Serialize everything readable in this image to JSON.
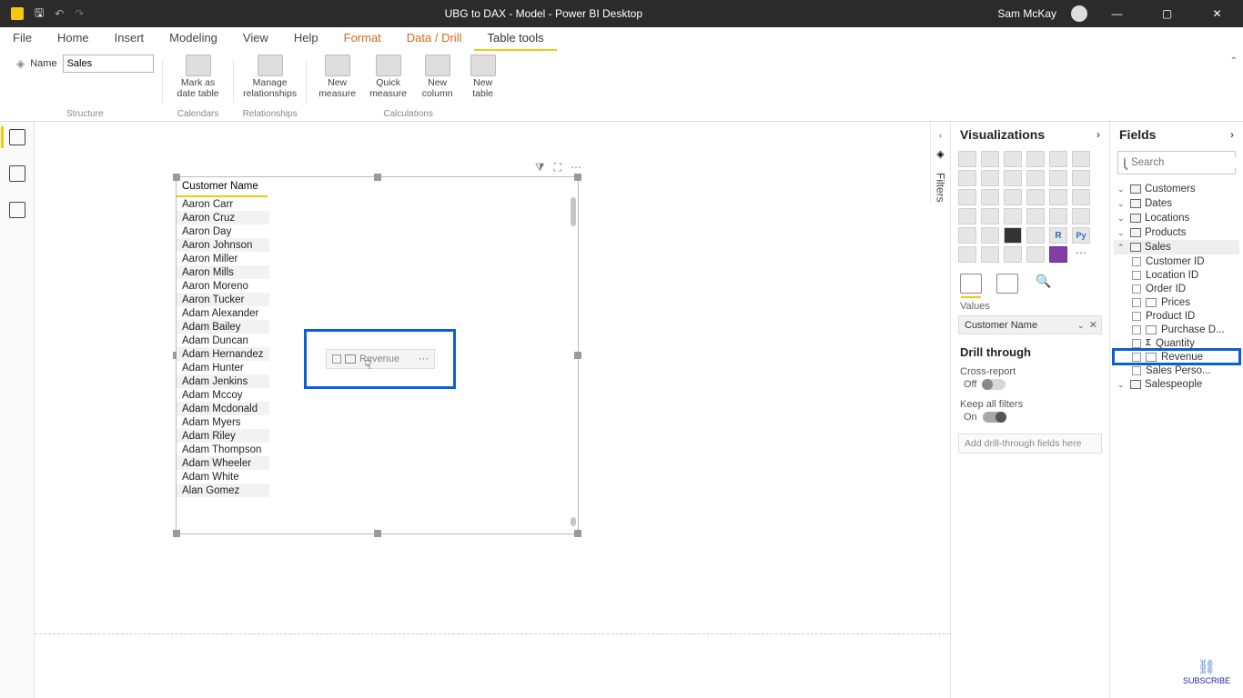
{
  "titlebar": {
    "title": "UBG to DAX - Model - Power BI Desktop",
    "user": "Sam McKay"
  },
  "menu": {
    "file": "File",
    "home": "Home",
    "insert": "Insert",
    "modeling": "Modeling",
    "view": "View",
    "help": "Help",
    "format": "Format",
    "datadrill": "Data / Drill",
    "tabletools": "Table tools"
  },
  "ribbon": {
    "name_label": "Name",
    "name_value": "Sales",
    "mark_date": "Mark as date table",
    "manage_rel": "Manage relationships",
    "new_measure": "New measure",
    "quick_measure": "Quick measure",
    "new_column": "New column",
    "new_table": "New table",
    "grp_structure": "Structure",
    "grp_calendars": "Calendars",
    "grp_relationships": "Relationships",
    "grp_calculations": "Calculations"
  },
  "filters_label": "Filters",
  "visual": {
    "header": "Customer Name",
    "rows": [
      "Aaron Carr",
      "Aaron Cruz",
      "Aaron Day",
      "Aaron Johnson",
      "Aaron Miller",
      "Aaron Mills",
      "Aaron Moreno",
      "Aaron Tucker",
      "Adam Alexander",
      "Adam Bailey",
      "Adam Duncan",
      "Adam Hernandez",
      "Adam Hunter",
      "Adam Jenkins",
      "Adam Mccoy",
      "Adam Mcdonald",
      "Adam Myers",
      "Adam Riley",
      "Adam Thompson",
      "Adam Wheeler",
      "Adam White",
      "Alan Gomez"
    ]
  },
  "drag_ghost": "Revenue",
  "viz": {
    "title": "Visualizations",
    "values_label": "Values",
    "value_field": "Customer Name",
    "drill_title": "Drill through",
    "cross_report": "Cross-report",
    "off": "Off",
    "keep_filters": "Keep all filters",
    "on": "On",
    "drill_drop": "Add drill-through fields here"
  },
  "fields": {
    "title": "Fields",
    "search_placeholder": "Search",
    "tables": {
      "customers": "Customers",
      "dates": "Dates",
      "locations": "Locations",
      "products": "Products",
      "sales": "Sales",
      "salespeople": "Salespeople"
    },
    "sales_fields": {
      "customer_id": "Customer ID",
      "location_id": "Location ID",
      "order_id": "Order ID",
      "prices": "Prices",
      "product_id": "Product ID",
      "purchase_d": "Purchase D...",
      "quantity": "Quantity",
      "revenue": "Revenue",
      "sales_perso": "Sales Perso..."
    }
  },
  "subscribe": "SUBSCRIBE"
}
